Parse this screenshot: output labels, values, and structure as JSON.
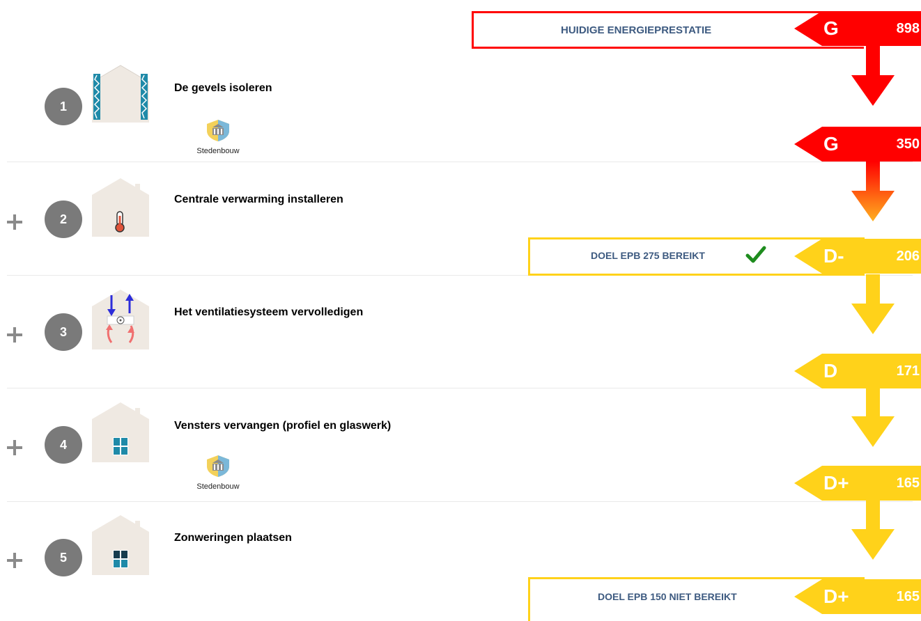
{
  "current": {
    "label": "HUIDIGE ENERGIEPRESTATIE",
    "grade": "G",
    "value": "898"
  },
  "steps": [
    {
      "number": "1",
      "title": "De gevels isoleren",
      "heritage": "Stedenbouw",
      "result": {
        "grade": "G",
        "value": "350"
      }
    },
    {
      "number": "2",
      "title": "Centrale verwarming installeren",
      "result": {
        "grade": "D-",
        "value": "206"
      },
      "goal": {
        "label": "DOEL EPB 275 BEREIKT",
        "reached": true
      }
    },
    {
      "number": "3",
      "title": "Het ventilatiesysteem vervolledigen",
      "result": {
        "grade": "D",
        "value": "171"
      }
    },
    {
      "number": "4",
      "title": "Vensters vervangen (profiel en glaswerk)",
      "heritage": "Stedenbouw",
      "result": {
        "grade": "D+",
        "value": "165"
      }
    },
    {
      "number": "5",
      "title": "Zonweringen plaatsen",
      "result": {
        "grade": "D+",
        "value": "165"
      },
      "goal": {
        "label": "DOEL EPB 150 NIET BEREIKT",
        "reached": false
      }
    }
  ],
  "colors": {
    "red": "#ff0000",
    "orange": "#ff9a1a",
    "yellow": "#ffd21a",
    "label_blue": "#3d5a80",
    "check_green": "#1e8c1e",
    "circle_grey": "#7a7a7a"
  }
}
